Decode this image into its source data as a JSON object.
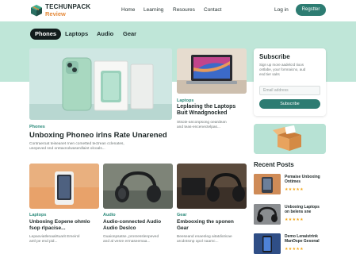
{
  "brand": {
    "name_top": "TECHUNPACK",
    "name_bottom": "Review"
  },
  "nav": {
    "items": [
      "Home",
      "Learning",
      "Resoures",
      "Contact"
    ],
    "login": "Log in",
    "register": "Regstter"
  },
  "tabs": [
    "Phones",
    "Laptops",
    "Audio",
    "Gear"
  ],
  "featured": {
    "category": "Phones",
    "title": "Unboxing Phoneo irlns Rate Unarened",
    "excerpt": [
      "Contraeroat teiseanet rnen cometted tectrean cclenates,",
      "unepeved snd oretaxnolwaserdlaint olcoals..."
    ]
  },
  "laptop_card": {
    "category": "Laptops",
    "title": [
      "Leplaeing the Laptops",
      "Buit Wnadgnocked"
    ],
    "excerpt": [
      "Stsoie-anconpsong oeardean",
      "and teas-encenectelpas..."
    ]
  },
  "cards": [
    {
      "category": "Laptops",
      "title": [
        "Unboxing Eopene ohmlo",
        "fsop rlpacise..."
      ],
      "excerpt": [
        "Lepaoviatlenaalrtuarit Emeirol",
        "antl pe end pid..."
      ]
    },
    {
      "category": "Audio",
      "title": [
        "Audio-connected Audio",
        "Audio Deslco"
      ],
      "excerpt": [
        "Guaionpsatse, prosresslenpeved",
        "and al vesre ermaseemaa..."
      ]
    },
    {
      "category": "Gear",
      "title": [
        "Embooxing the sponen",
        "Gear"
      ],
      "excerpt": [
        "Beeseand enaenleg aitatdioticae",
        "arcdntsmp opol naamc..."
      ]
    }
  ],
  "subscribe": {
    "title": "Subscribe",
    "text": [
      "Sign up more aadelcrd tioos",
      "ontlabe, your fornnaicno, aud",
      "end tier salrs"
    ],
    "placeholder": "Email address",
    "button": "Subscribe"
  },
  "recent": {
    "heading": "Recent Posts",
    "items": [
      {
        "title": [
          "Pemaise Unboxing",
          "Ontimes"
        ],
        "stars": "★★★★★"
      },
      {
        "title": [
          "Unboxing Laptops",
          "on belens sne"
        ],
        "stars": "★★★★★"
      },
      {
        "title": [
          "Demo Lenaistrink",
          "ManOspe Gesonal"
        ],
        "stars": "★★★★★"
      }
    ]
  },
  "colors": {
    "accent": "#2d7c72",
    "mint": "#bfe6d8",
    "brand_orange": "#e58a3a",
    "stars": "#f2a71b"
  }
}
